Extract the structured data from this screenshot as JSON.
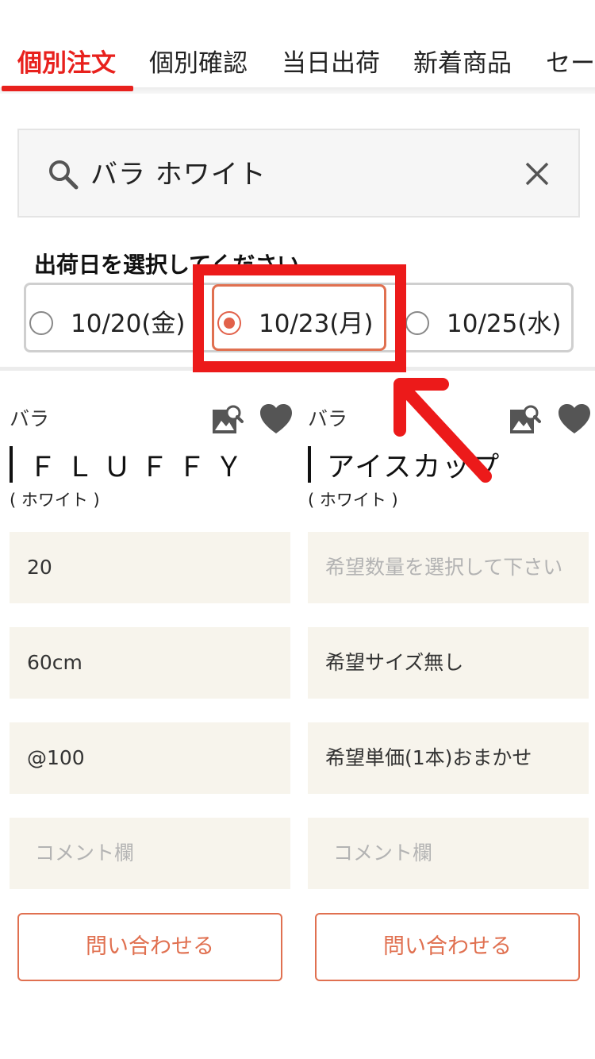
{
  "tabs": [
    {
      "label": "個別注文",
      "active": true
    },
    {
      "label": "個別確認",
      "active": false
    },
    {
      "label": "当日出荷",
      "active": false
    },
    {
      "label": "新着商品",
      "active": false
    },
    {
      "label": "セー",
      "active": false
    }
  ],
  "search": {
    "value": "バラ ホワイト",
    "icon": "search-icon",
    "clear_icon": "close-icon"
  },
  "ship_date": {
    "title": "出荷日を選択してください",
    "options": [
      {
        "label": "10/20(金)",
        "selected": false
      },
      {
        "label": "10/23(月)",
        "selected": true
      },
      {
        "label": "10/25(水)",
        "selected": false
      }
    ]
  },
  "products": [
    {
      "category": "バラ",
      "name": "ＦＬＵＦＦＹ",
      "color": "( ホワイト )",
      "quantity": "20",
      "size": "60cm",
      "price": "@100",
      "comment_placeholder": "コメント欄",
      "inquiry_label": "問い合わせる"
    },
    {
      "category": "バラ",
      "name": "アイスカップ",
      "color": "( ホワイト )",
      "quantity_placeholder": "希望数量を選択して下さい",
      "size": "希望サイズ無し",
      "price": "希望単価(1本)おまかせ",
      "comment_placeholder": "コメント欄",
      "inquiry_label": "問い合わせる"
    }
  ],
  "colors": {
    "accent_red": "#e8211d",
    "radio_selected": "#e2614a",
    "button_outline": "#e07050",
    "field_bg": "#f7f4ec",
    "annotation_red": "#ec1a1a"
  }
}
